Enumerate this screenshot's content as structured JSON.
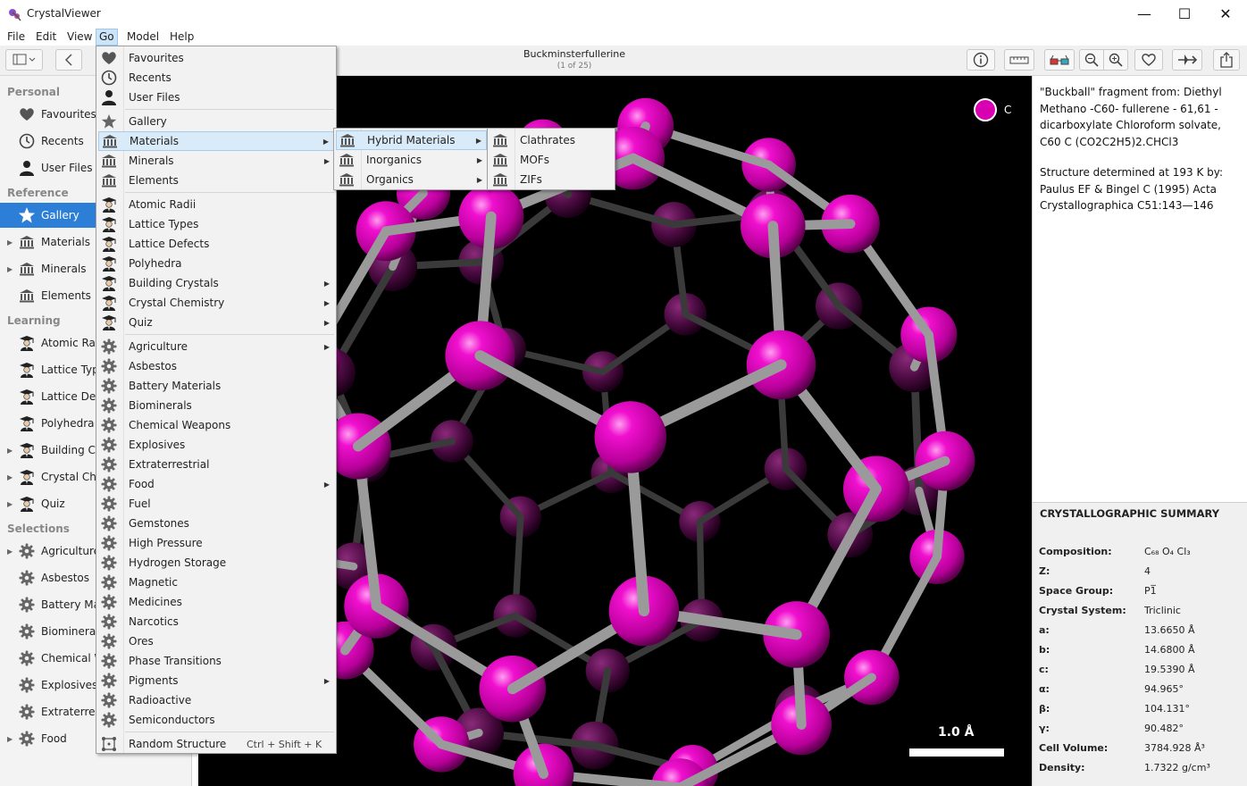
{
  "window": {
    "title": "CrystalViewer"
  },
  "menubar": [
    "File",
    "Edit",
    "View",
    "Go",
    "Model",
    "Help"
  ],
  "structure": {
    "title": "Buckminsterfullerine",
    "position": "(1 of 25)"
  },
  "sidebar": {
    "sections": [
      {
        "label": "Personal",
        "items": [
          {
            "label": "Favourites",
            "icon": "heart-icon",
            "arrow": false
          },
          {
            "label": "Recents",
            "icon": "clock-icon",
            "arrow": false
          },
          {
            "label": "User Files",
            "icon": "user-icon",
            "arrow": false
          }
        ]
      },
      {
        "label": "Reference",
        "items": [
          {
            "label": "Gallery",
            "icon": "star-icon",
            "arrow": false,
            "selected": true
          },
          {
            "label": "Materials",
            "icon": "museum-icon",
            "arrow": true
          },
          {
            "label": "Minerals",
            "icon": "museum-icon",
            "arrow": true
          },
          {
            "label": "Elements",
            "icon": "museum-icon",
            "arrow": false
          }
        ]
      },
      {
        "label": "Learning",
        "items": [
          {
            "label": "Atomic Rad",
            "icon": "scholar-icon",
            "arrow": false
          },
          {
            "label": "Lattice Type",
            "icon": "scholar-icon",
            "arrow": false
          },
          {
            "label": "Lattice Defe",
            "icon": "scholar-icon",
            "arrow": false
          },
          {
            "label": "Polyhedra",
            "icon": "scholar-icon",
            "arrow": false
          },
          {
            "label": "Building Cry",
            "icon": "scholar-icon",
            "arrow": true
          },
          {
            "label": "Crystal Che",
            "icon": "scholar-icon",
            "arrow": true
          },
          {
            "label": "Quiz",
            "icon": "scholar-icon",
            "arrow": true
          }
        ]
      },
      {
        "label": "Selections",
        "items": [
          {
            "label": "Agriculture",
            "icon": "gear-icon",
            "arrow": true
          },
          {
            "label": "Asbestos",
            "icon": "gear-icon",
            "arrow": false
          },
          {
            "label": "Battery Mat",
            "icon": "gear-icon",
            "arrow": false
          },
          {
            "label": "Biominerals",
            "icon": "gear-icon",
            "arrow": false
          },
          {
            "label": "Chemical W",
            "icon": "gear-icon",
            "arrow": false
          },
          {
            "label": "Explosives",
            "icon": "gear-icon",
            "arrow": false
          },
          {
            "label": "Extraterrest",
            "icon": "gear-icon",
            "arrow": false
          },
          {
            "label": "Food",
            "icon": "gear-icon",
            "arrow": true
          }
        ]
      }
    ]
  },
  "go_menu": [
    {
      "label": "Favourites",
      "icon": "heart-icon"
    },
    {
      "label": "Recents",
      "icon": "clock-icon"
    },
    {
      "label": "User Files",
      "icon": "user-icon"
    },
    {
      "sep": true
    },
    {
      "label": "Gallery",
      "icon": "star-icon"
    },
    {
      "label": "Materials",
      "icon": "museum-icon",
      "sub": true,
      "hl": true
    },
    {
      "label": "Minerals",
      "icon": "museum-icon",
      "sub": true
    },
    {
      "label": "Elements",
      "icon": "museum-icon"
    },
    {
      "sep": true
    },
    {
      "label": "Atomic Radii",
      "icon": "scholar-icon"
    },
    {
      "label": "Lattice Types",
      "icon": "scholar-icon"
    },
    {
      "label": "Lattice Defects",
      "icon": "scholar-icon"
    },
    {
      "label": "Polyhedra",
      "icon": "scholar-icon"
    },
    {
      "label": "Building Crystals",
      "icon": "scholar-icon",
      "sub": true
    },
    {
      "label": "Crystal Chemistry",
      "icon": "scholar-icon",
      "sub": true
    },
    {
      "label": "Quiz",
      "icon": "scholar-icon",
      "sub": true
    },
    {
      "sep": true
    },
    {
      "label": "Agriculture",
      "icon": "gear-icon",
      "sub": true
    },
    {
      "label": "Asbestos",
      "icon": "gear-icon"
    },
    {
      "label": "Battery Materials",
      "icon": "gear-icon"
    },
    {
      "label": "Biominerals",
      "icon": "gear-icon"
    },
    {
      "label": "Chemical Weapons",
      "icon": "gear-icon"
    },
    {
      "label": "Explosives",
      "icon": "gear-icon"
    },
    {
      "label": "Extraterrestrial",
      "icon": "gear-icon"
    },
    {
      "label": "Food",
      "icon": "gear-icon",
      "sub": true
    },
    {
      "label": "Fuel",
      "icon": "gear-icon"
    },
    {
      "label": "Gemstones",
      "icon": "gear-icon"
    },
    {
      "label": "High Pressure",
      "icon": "gear-icon"
    },
    {
      "label": "Hydrogen Storage",
      "icon": "gear-icon"
    },
    {
      "label": "Magnetic",
      "icon": "gear-icon"
    },
    {
      "label": "Medicines",
      "icon": "gear-icon"
    },
    {
      "label": "Narcotics",
      "icon": "gear-icon"
    },
    {
      "label": "Ores",
      "icon": "gear-icon"
    },
    {
      "label": "Phase Transitions",
      "icon": "gear-icon"
    },
    {
      "label": "Pigments",
      "icon": "gear-icon",
      "sub": true
    },
    {
      "label": "Radioactive",
      "icon": "gear-icon"
    },
    {
      "label": "Semiconductors",
      "icon": "gear-icon"
    },
    {
      "sep": true
    },
    {
      "label": "Random Structure",
      "icon": "random-icon",
      "shortcut": "Ctrl + Shift + K"
    }
  ],
  "materials_menu": [
    {
      "label": "Hybrid Materials",
      "icon": "museum-icon",
      "sub": true,
      "hl": true
    },
    {
      "label": "Inorganics",
      "icon": "museum-icon",
      "sub": true
    },
    {
      "label": "Organics",
      "icon": "museum-icon",
      "sub": true
    }
  ],
  "hybrid_menu": [
    {
      "label": "Clathrates",
      "icon": "museum-icon"
    },
    {
      "label": "MOFs",
      "icon": "museum-icon"
    },
    {
      "label": "ZIFs",
      "icon": "museum-icon"
    }
  ],
  "viewer": {
    "legend_element": "C",
    "atom_color": "#d800b0",
    "scale_label": "1.0 Å"
  },
  "info": {
    "paragraph1": "\"Buckball\" fragment from: Diethyl Methano -C60- fullerene - 61,61 - dicarboxylate Chloroform solvate, C60 C (CO2C2H5)2.CHCl3",
    "paragraph2": "Structure determined at 193 K by: Paulus EF & Bingel C (1995) Acta Crystallographica C51:143—146"
  },
  "summary": {
    "title": "CRYSTALLOGRAPHIC SUMMARY",
    "rows": [
      {
        "key": "Composition:",
        "value": "C₆₈ O₄ Cl₃"
      },
      {
        "key": "Z:",
        "value": "4"
      },
      {
        "key": "Space Group:",
        "value": "P1̅"
      },
      {
        "key": "Crystal System:",
        "value": "Triclinic"
      },
      {
        "key": "a:",
        "value": "13.6650 Å"
      },
      {
        "key": "b:",
        "value": "14.6800 Å"
      },
      {
        "key": "c:",
        "value": "19.5390 Å"
      },
      {
        "key": "α:",
        "value": "94.965°"
      },
      {
        "key": "β:",
        "value": "104.131°"
      },
      {
        "key": "γ:",
        "value": "90.482°"
      },
      {
        "key": "Cell Volume:",
        "value": "3784.928 Å³"
      },
      {
        "key": "Density:",
        "value": "1.7322 g/cm³"
      }
    ]
  }
}
